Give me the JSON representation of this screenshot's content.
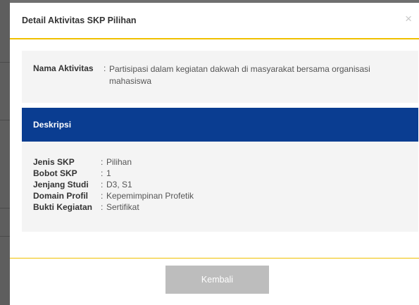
{
  "modal": {
    "title": "Detail Aktivitas SKP Pilihan",
    "close_symbol": "×",
    "activity": {
      "label": "Nama Aktivitas",
      "separator": ":",
      "value": "Partisipasi dalam kegiatan dakwah di masyarakat bersama organisasi mahasiswa"
    },
    "description": {
      "title": "Deskripsi",
      "rows": [
        {
          "key": "Jenis SKP",
          "sep": ":",
          "value": "Pilihan"
        },
        {
          "key": "Bobot SKP",
          "sep": ":",
          "value": "1"
        },
        {
          "key": "Jenjang Studi",
          "sep": ":",
          "value": "D3, S1"
        },
        {
          "key": "Domain Profil",
          "sep": ":",
          "value": "Kepemimpinan Profetik"
        },
        {
          "key": "Bukti Kegiatan",
          "sep": ":",
          "value": "Sertifikat"
        }
      ]
    },
    "back_label": "Kembali"
  },
  "colors": {
    "accent_line": "#f0c000",
    "header_blue": "#0a3d91",
    "button_gray": "#bdbdbd"
  }
}
